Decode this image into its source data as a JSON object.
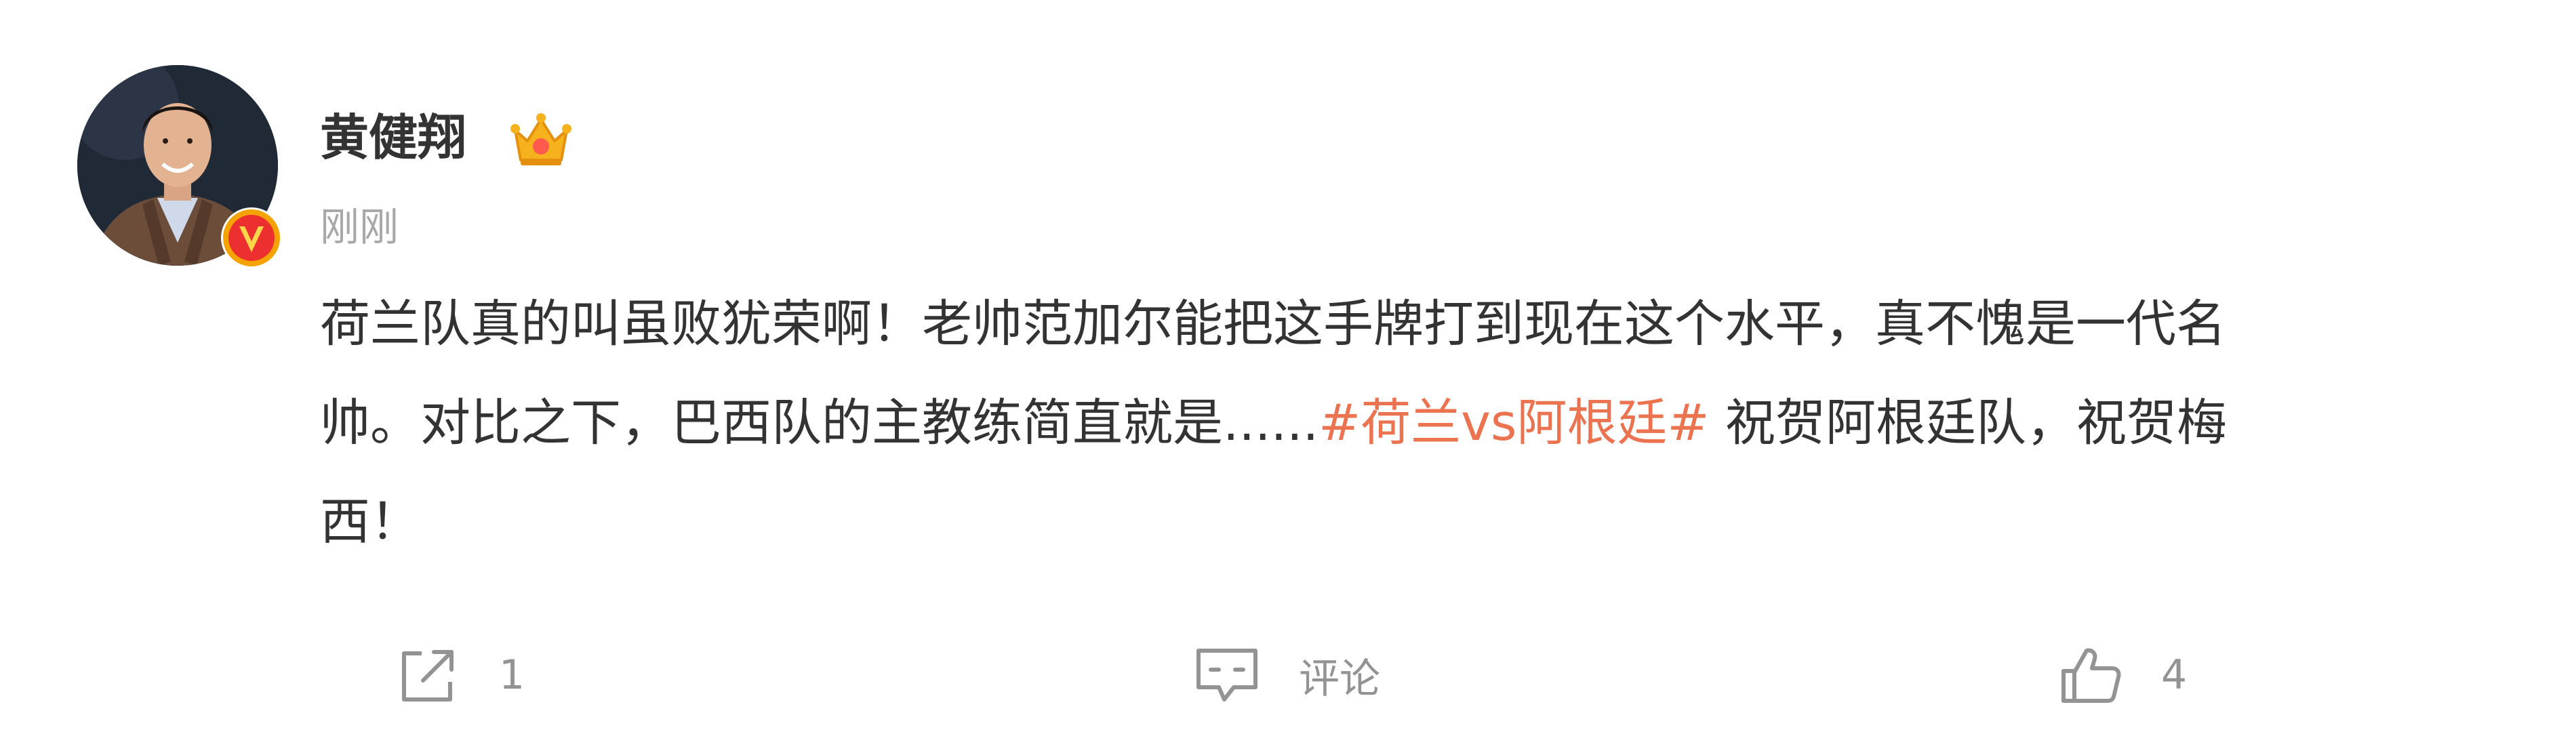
{
  "post": {
    "author": {
      "name": "黄健翔",
      "avatar_icon": "avatar-photo",
      "verified_icon": "verified-v-badge",
      "member_icon": "crown-icon"
    },
    "timestamp": "刚刚",
    "content": {
      "line1": "荷兰队真的叫虽败犹荣啊！老帅范加尔能把这手牌打到现在这个水平，真不愧是一代名",
      "line2_before": "帅。对比之下，巴西队的主教练简直就是......",
      "hashtag": "#荷兰vs阿根廷#",
      "line2_after": " 祝贺阿根廷队，祝贺梅",
      "line3": "西！"
    },
    "actions": {
      "repost": {
        "icon": "share-icon",
        "label": "1"
      },
      "comment": {
        "icon": "comment-icon",
        "label": "评论"
      },
      "like": {
        "icon": "thumbs-up-icon",
        "label": "4"
      }
    }
  },
  "colors": {
    "text": "#333333",
    "muted": "#a8a8a8",
    "action": "#939393",
    "hashtag": "#eb7350",
    "verified": "#f5a300"
  }
}
